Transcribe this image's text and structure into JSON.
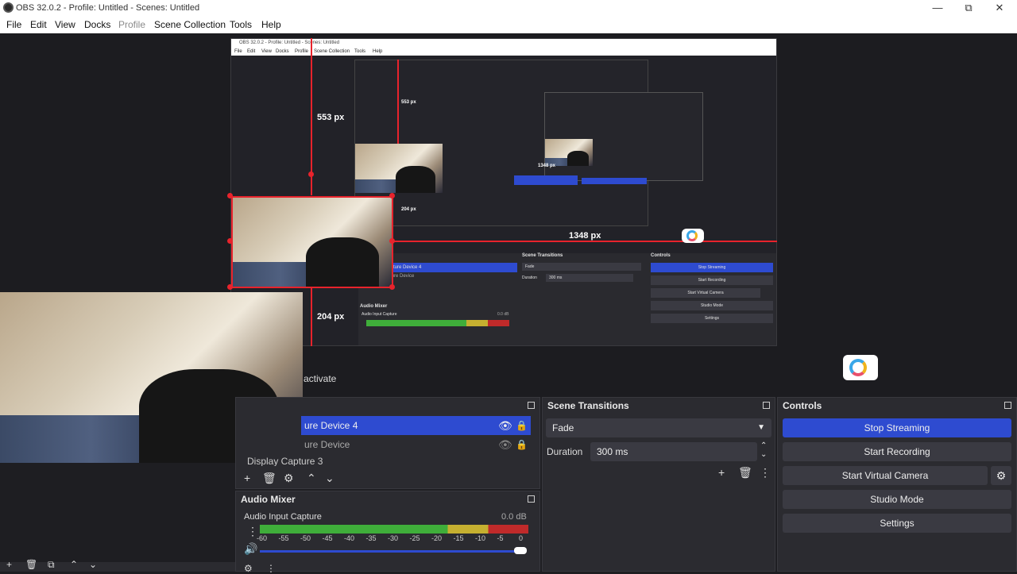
{
  "window": {
    "title": "OBS 32.0.2 - Profile: Untitled - Scenes: Untitled",
    "minimize": "—",
    "restore": "⧉",
    "close": "✕"
  },
  "menu": [
    "File",
    "Edit",
    "View",
    "Docks",
    "Profile",
    "Scene Collection",
    "Tools",
    "Help"
  ],
  "nested": {
    "title": "OBS 32.0.2 - Profile: Untitled - Scenes: Untitled",
    "menu": [
      "File",
      "Edit",
      "View",
      "Docks",
      "Profile",
      "Scene Collection",
      "Tools",
      "Help"
    ],
    "sources_selected": "ture Device 4",
    "sources_other": "ture Device",
    "scene_transitions": "Scene Transitions",
    "fade": "Fade",
    "duration_label": "Duration",
    "duration": "300 ms",
    "controls": "Controls",
    "stop_streaming": "Stop Streaming",
    "start_recording": "Start Recording",
    "start_virtual_camera": "Start Virtual Camera",
    "studio_mode": "Studio Mode",
    "settings": "Settings",
    "audio_mixer": "Audio Mixer",
    "audio_input": "Audio Input Capture",
    "db": "0.0 dB"
  },
  "measurements": {
    "height_top": "553 px",
    "width_main": "1348 px",
    "height_side": "204 px",
    "height_top_small": "553 px",
    "width_small": "1348 px",
    "height_side_small": "204 px"
  },
  "activate_text": "activate",
  "sources": {
    "rows": [
      {
        "label": "ure Device 4",
        "selected": true
      },
      {
        "label": "ure Device",
        "selected": false
      },
      {
        "label": "Display Capture 3",
        "selected": false
      }
    ]
  },
  "scene_transitions": {
    "title": "Scene Transitions",
    "transition": "Fade",
    "duration_label": "Duration",
    "duration_value": "300 ms"
  },
  "controls": {
    "title": "Controls",
    "stop_streaming": "Stop Streaming",
    "start_recording": "Start Recording",
    "start_virtual_camera": "Start Virtual Camera",
    "studio_mode": "Studio Mode",
    "settings": "Settings"
  },
  "audio_mixer": {
    "title": "Audio Mixer",
    "channel": "Audio Input Capture",
    "level": "0.0 dB",
    "ticks": [
      "-60",
      "-55",
      "-50",
      "-45",
      "-40",
      "-35",
      "-30",
      "-25",
      "-20",
      "-15",
      "-10",
      "-5",
      "0"
    ],
    "volume_fraction": 1.0
  },
  "colors": {
    "accent": "#2e4bd0",
    "measure_line": "#e8232c",
    "meter_green": "#3fae3a",
    "meter_yellow": "#c6b030",
    "meter_red": "#c02a2a"
  }
}
